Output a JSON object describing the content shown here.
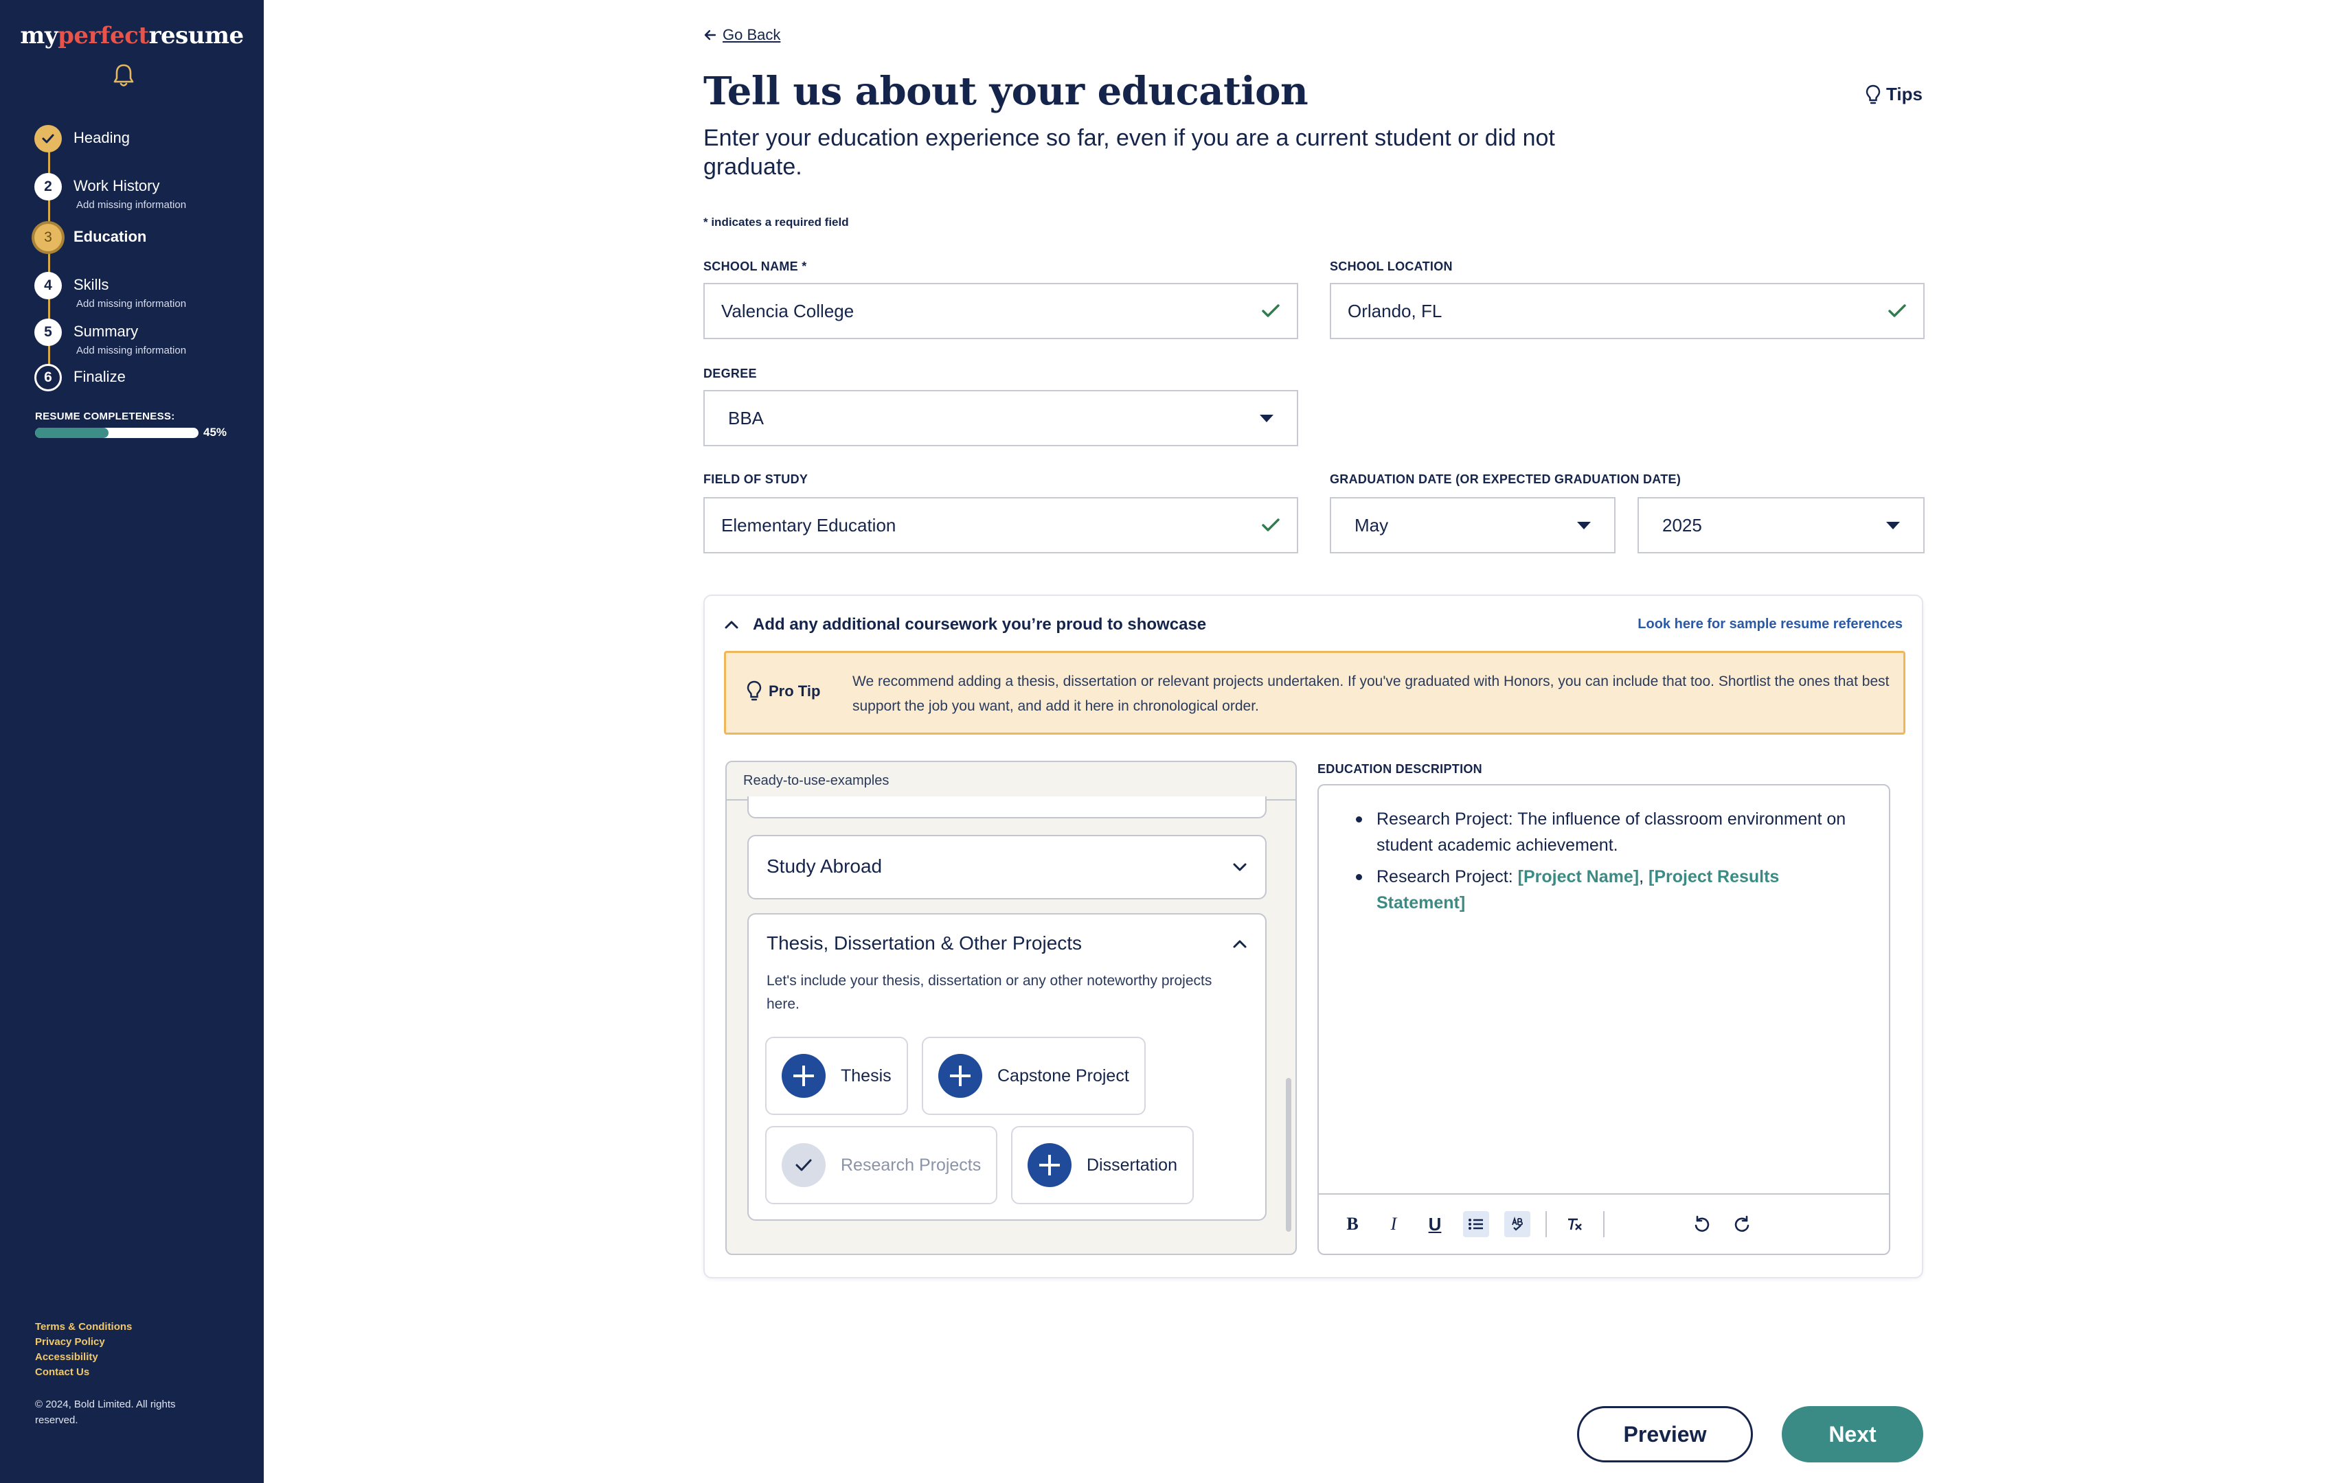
{
  "brand": {
    "logo_pre": "my",
    "logo_accent": "perfect",
    "logo_post": "resume"
  },
  "sidebar": {
    "steps": [
      {
        "number": "",
        "label": "Heading",
        "sub": ""
      },
      {
        "number": "2",
        "label": "Work History",
        "sub": "Add missing information"
      },
      {
        "number": "3",
        "label": "Education",
        "sub": ""
      },
      {
        "number": "4",
        "label": "Skills",
        "sub": "Add missing information"
      },
      {
        "number": "5",
        "label": "Summary",
        "sub": "Add missing information"
      },
      {
        "number": "6",
        "label": "Finalize",
        "sub": ""
      }
    ],
    "completeness_label": "RESUME COMPLETENESS:",
    "completeness_value": 45,
    "completeness_text": "45%",
    "footer_links": [
      "Terms & Conditions",
      "Privacy Policy",
      "Accessibility",
      "Contact Us"
    ],
    "copyright": "© 2024, Bold Limited. All rights reserved."
  },
  "header": {
    "go_back": "Go Back",
    "title": "Tell us about your education",
    "tips": "Tips",
    "subtitle": "Enter your education experience so far, even if you are a current student or did not graduate.",
    "required_note": "* indicates a required field"
  },
  "form": {
    "school_name_label": "SCHOOL NAME *",
    "school_name_value": "Valencia College",
    "school_location_label": "SCHOOL LOCATION",
    "school_location_value": "Orlando, FL",
    "degree_label": "DEGREE",
    "degree_value": "BBA",
    "field_label": "FIELD OF STUDY",
    "field_value": "Elementary Education",
    "grad_label": "GRADUATION DATE (OR EXPECTED GRADUATION DATE)",
    "grad_month": "May",
    "grad_year": "2025"
  },
  "coursework": {
    "header": "Add any additional coursework you’re proud to showcase",
    "link": "Look here for sample resume references",
    "protip_label": "Pro Tip",
    "protip_text": "We recommend adding a thesis, dissertation or relevant projects undertaken. If you've graduated with Honors, you can include that too. Shortlist the ones that best support the job you want, and add it here in chronological order.",
    "examples_label": "Ready-to-use-examples",
    "card_study_abroad": "Study Abroad",
    "card_thesis_title": "Thesis, Dissertation & Other Projects",
    "card_thesis_desc": "Let's include your thesis, dissertation or any other noteworthy projects here.",
    "chips": [
      "Thesis",
      "Capstone Project",
      "Research Projects",
      "Dissertation"
    ],
    "desc_label": "EDUCATION DESCRIPTION",
    "bullet1": "Research Project: The influence of classroom environment on student academic achievement.",
    "bullet2_prefix": "Research Project: ",
    "bullet2_ph1": "[Project Name]",
    "bullet2_sep": ", ",
    "bullet2_ph2": "[Project Results Statement]"
  },
  "actions": {
    "preview": "Preview",
    "next": "Next"
  },
  "colors": {
    "sidebar_bg": "#15244a",
    "accent_gold": "#e6b860",
    "teal": "#3a8a86",
    "logo_red": "#e8544a",
    "protip_bg": "#fbebd0"
  }
}
